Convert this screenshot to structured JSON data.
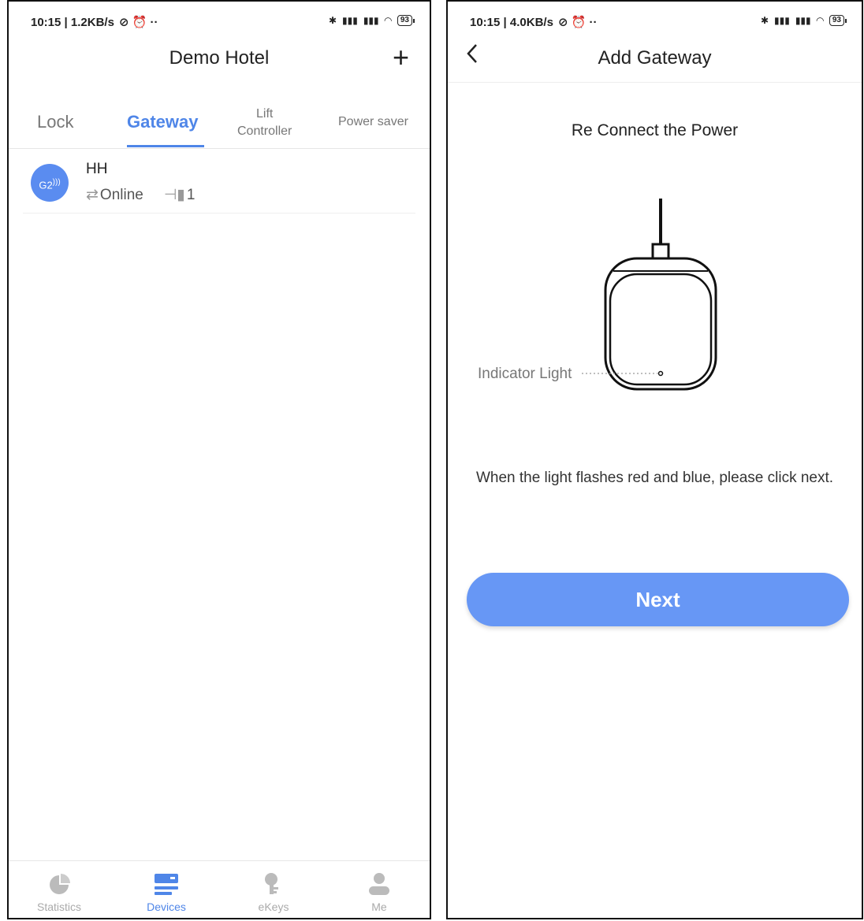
{
  "left_screen": {
    "status": {
      "time": "10:15 | 1.2KB/s",
      "icons": "⊘ ⏰ ··",
      "battery": "93"
    },
    "header": {
      "title": "Demo Hotel",
      "add_label": "+"
    },
    "tabs": [
      {
        "label": "Lock"
      },
      {
        "label": "Gateway"
      },
      {
        "label": "Lift\nController"
      },
      {
        "label": "Power saver"
      }
    ],
    "gateway": {
      "avatar": "G2",
      "name": "HH",
      "status": "Online",
      "count": "1"
    },
    "nav": [
      {
        "label": "Statistics",
        "icon": "pie-chart-icon"
      },
      {
        "label": "Devices",
        "icon": "devices-icon"
      },
      {
        "label": "eKeys",
        "icon": "key-icon"
      },
      {
        "label": "Me",
        "icon": "user-icon"
      }
    ]
  },
  "right_screen": {
    "status": {
      "time": "10:15 | 4.0KB/s",
      "icons": "⊘ ⏰ ··",
      "battery": "93"
    },
    "header": {
      "title": "Add Gateway",
      "back_label": "<"
    },
    "heading": "Re Connect the Power",
    "indicator_label": "Indicator Light",
    "instructions": "When the light flashes red and blue, please click next.",
    "next_label": "Next"
  },
  "colors": {
    "accent": "#4f86e8",
    "button": "#6797f5",
    "avatar": "#5a8cf0"
  }
}
